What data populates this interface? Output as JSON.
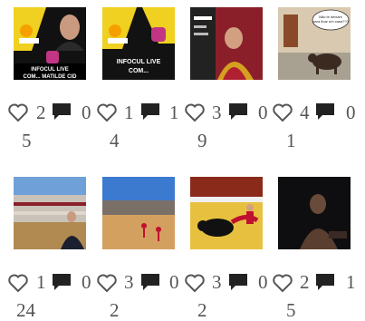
{
  "posts": [
    {
      "id": "p1",
      "overlay_text": "INFOCUL LIVE COM... MATILDE CID",
      "logo": "infocul.pt",
      "likes": "2",
      "comments": "0",
      "second_line": "5"
    },
    {
      "id": "p2",
      "overlay_text": "INFOCUL LIVE COM...",
      "logo": "infocul.pt",
      "likes": "1",
      "comments": "1",
      "second_line": "4"
    },
    {
      "id": "p3",
      "overlay_text": "",
      "logo": "infocul.pt",
      "likes": "3",
      "comments": "0",
      "second_line": "9"
    },
    {
      "id": "p4",
      "overlay_text": "Não te deixam para ficar em casa???",
      "logo": "",
      "likes": "4",
      "comments": "0",
      "second_line": "1"
    },
    {
      "id": "p5",
      "overlay_text": "",
      "logo": "",
      "likes": "1",
      "comments": "0",
      "second_line": "24"
    },
    {
      "id": "p6",
      "overlay_text": "",
      "logo": "",
      "likes": "3",
      "comments": "0",
      "second_line": "2"
    },
    {
      "id": "p7",
      "overlay_text": "",
      "logo": "",
      "likes": "3",
      "comments": "0",
      "second_line": "2"
    },
    {
      "id": "p8",
      "overlay_text": "",
      "logo": "",
      "likes": "2",
      "comments": "1",
      "second_line": "5"
    }
  ]
}
